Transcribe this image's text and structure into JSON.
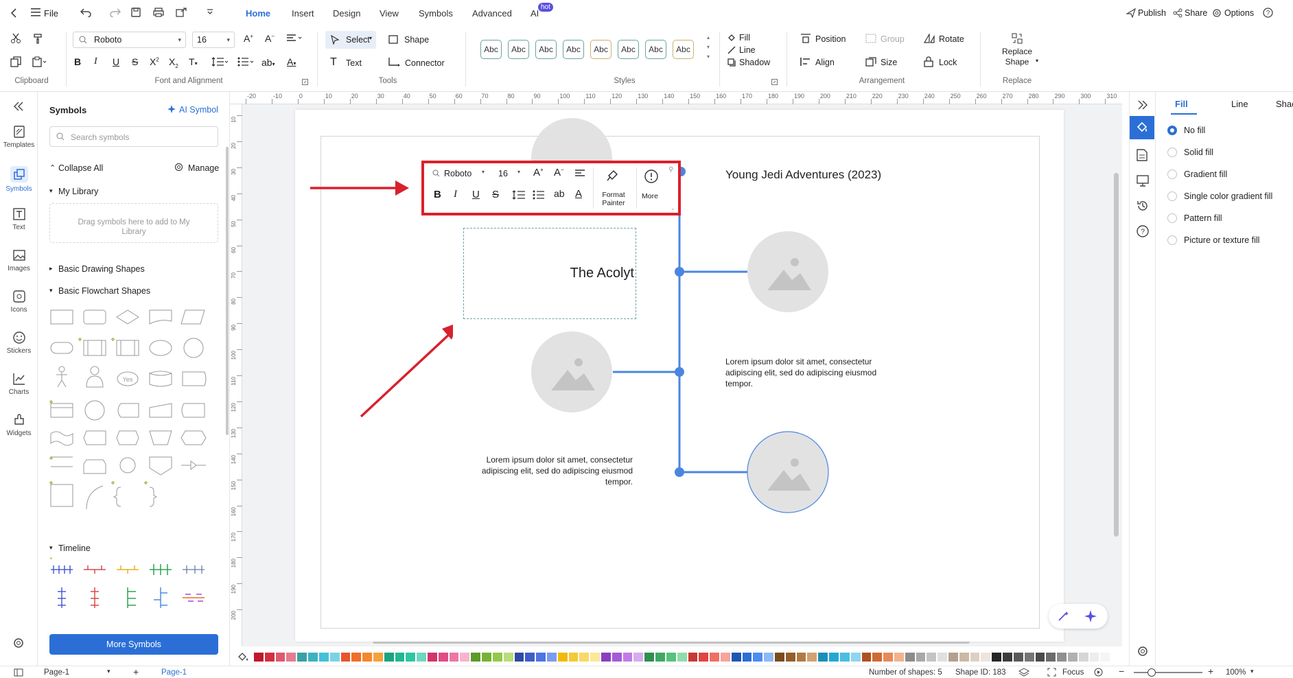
{
  "menu": {
    "file": "File",
    "tabs": [
      "Home",
      "Insert",
      "Design",
      "View",
      "Symbols",
      "Advanced",
      "AI"
    ],
    "ai_badge": "hot",
    "publish": "Publish",
    "share": "Share",
    "options": "Options"
  },
  "ribbon": {
    "font_name": "Roboto",
    "font_size": "16",
    "select": "Select",
    "shape": "Shape",
    "text": "Text",
    "connector": "Connector",
    "abc": "Abc",
    "fill": "Fill",
    "line": "Line",
    "shadow": "Shadow",
    "position": "Position",
    "group": "Group",
    "rotate": "Rotate",
    "align": "Align",
    "size": "Size",
    "lock": "Lock",
    "replace_shape": "Replace Shape",
    "groups": [
      "Clipboard",
      "Font and Alignment",
      "Tools",
      "Styles",
      "Arrangement",
      "Replace"
    ]
  },
  "rail": [
    "Templates",
    "Symbols",
    "Text",
    "Images",
    "Icons",
    "Stickers",
    "Charts",
    "Widgets"
  ],
  "panel": {
    "title": "Symbols",
    "ai_symbol": "AI Symbol",
    "search_placeholder": "Search symbols",
    "collapse_all": "Collapse All",
    "manage": "Manage",
    "my_library": "My Library",
    "drag_hint": "Drag symbols here to add to My Library",
    "basic_drawing": "Basic Drawing Shapes",
    "basic_flowchart": "Basic Flowchart Shapes",
    "timeline": "Timeline",
    "more_symbols": "More Symbols",
    "yes_label": "Yes"
  },
  "ruler_top": [
    "-20",
    "-10",
    "0",
    "10",
    "20",
    "30",
    "40",
    "50",
    "60",
    "70",
    "80",
    "90",
    "100",
    "110",
    "120",
    "130",
    "140",
    "150",
    "160",
    "170",
    "180",
    "190",
    "200",
    "210",
    "220",
    "230",
    "240",
    "250",
    "260",
    "270",
    "280",
    "290",
    "300",
    "310"
  ],
  "ruler_left": [
    "10",
    "20",
    "30",
    "40",
    "50",
    "60",
    "70",
    "80",
    "90",
    "100",
    "110",
    "120",
    "130",
    "140",
    "150",
    "160",
    "170",
    "180",
    "190",
    "200"
  ],
  "canvas": {
    "title_text": "Young Jedi Adventures (2023)",
    "selected_text": "The Acolyt",
    "lorem_right": "Lorem ipsum dolor sit amet, consectetur adipiscing elit, sed do adipiscing eiusmod tempor.",
    "lorem_left": "Lorem ipsum dolor sit amet, consectetur adipiscing elit, sed do adipiscing eiusmod tempor."
  },
  "mini_toolbar": {
    "font": "Roboto",
    "size": "16",
    "format_painter": "Format Painter",
    "more": "More"
  },
  "rightpanel": {
    "tabs": [
      "Fill",
      "Line",
      "Shac"
    ],
    "options": [
      "No fill",
      "Solid fill",
      "Gradient fill",
      "Single color gradient fill",
      "Pattern fill",
      "Picture or texture fill"
    ]
  },
  "status": {
    "page_select": "Page-1",
    "page_tab": "Page-1",
    "shapes": "Number of shapes: 5",
    "shape_id": "Shape ID: 183",
    "focus": "Focus",
    "zoom": "100%"
  },
  "colors": {
    "accent": "#2b6fd6",
    "timeline_blue": "#4a86e0",
    "highlight_red": "#d9212d",
    "placeholder_grey": "#e2e2e2"
  },
  "palette": [
    "#c0182c",
    "#d32f43",
    "#e05a6e",
    "#e67c8f",
    "#39a0a3",
    "#3db1c0",
    "#42c1d8",
    "#7ad3e5",
    "#e8542d",
    "#ef6f2a",
    "#f4882c",
    "#f6a13a",
    "#19a57d",
    "#23b790",
    "#2ec7a2",
    "#6fd8c0",
    "#d1356a",
    "#e04c86",
    "#ee75a6",
    "#f7b4cf",
    "#5b9b2a",
    "#76b335",
    "#95c94a",
    "#b9dd77",
    "#2f4aa3",
    "#3e5ec5",
    "#4d75e3",
    "#7b9bf0",
    "#f1b90d",
    "#f5c938",
    "#f8d867",
    "#fbe89a",
    "#8a3fbf",
    "#a55ad6",
    "#c07ce6",
    "#d9aaf0",
    "#2e8f4f",
    "#3fa964",
    "#55c27e",
    "#8fdcab",
    "#c73a34",
    "#e1453e",
    "#f07066",
    "#f6a49c",
    "#1f57b5",
    "#2d6fd4",
    "#4b8df0",
    "#8fb8f7",
    "#7a4b1e",
    "#955f2a",
    "#b27a43",
    "#d0a272",
    "#1a8fb8",
    "#23a7d3",
    "#4bbde3",
    "#8fd5ef",
    "#b05020",
    "#cf6a34",
    "#e58a58",
    "#f1b38e",
    "#8c8c8c",
    "#a8a8a8",
    "#c4c4c4",
    "#e0e0e0",
    "#b3a08c",
    "#cbb9a6",
    "#ddd0c2",
    "#ede5dc",
    "#262626",
    "#3d3d3d",
    "#595959",
    "#757575",
    "#4a4a4a",
    "#6b6b6b",
    "#8f8f8f",
    "#b0b0b0",
    "#d6d6d6",
    "#ededed",
    "#f5f5f5",
    "#ffffff"
  ]
}
